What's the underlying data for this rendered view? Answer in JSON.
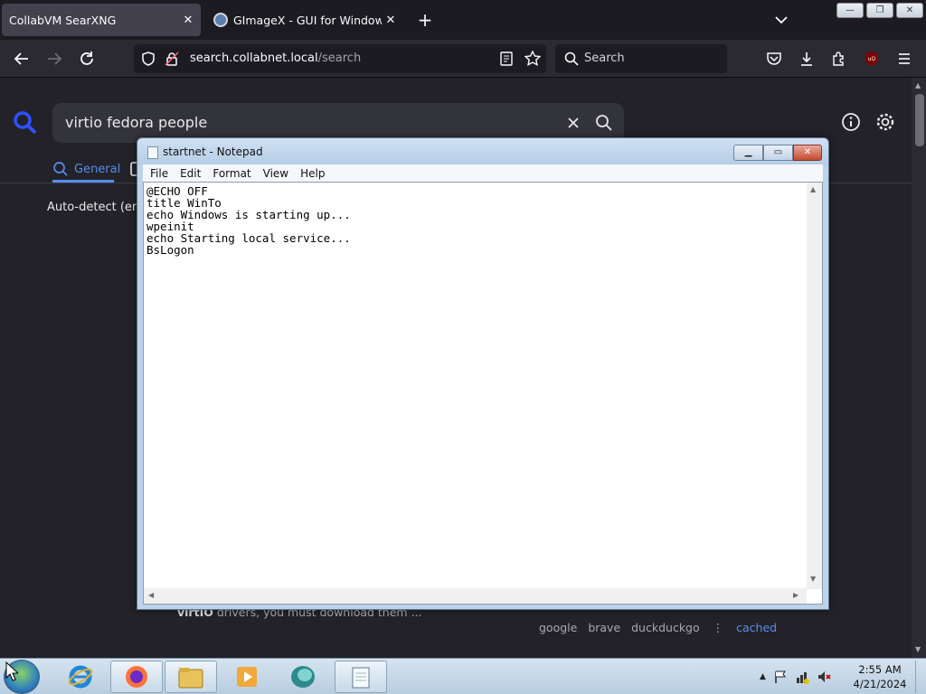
{
  "browser": {
    "tabs": [
      {
        "title": "CollabVM SearXNG",
        "active": true
      },
      {
        "title": "GImageX - GUI for Windows Im",
        "active": false
      }
    ],
    "url_domain": "search.collabnet.local",
    "url_path": "/search",
    "search_placeholder": "Search"
  },
  "page": {
    "query": "virtio fedora people",
    "tab_general": "General",
    "lang_filter": "Auto-detect (en-U",
    "snippet_bold": "virtIO",
    "snippet_rest": " drivers, you must download them ...",
    "engines": [
      "google",
      "brave",
      "duckduckgo"
    ],
    "engine_sep": "⋮",
    "cached": "cached",
    "accent_color": "#5a8dee"
  },
  "notepad": {
    "title": "startnet - Notepad",
    "menu": [
      "File",
      "Edit",
      "Format",
      "View",
      "Help"
    ],
    "content": "@ECHO OFF\ntitle WinTo\necho Windows is starting up...\nwpeinit\necho Starting local service...\nBsLogon"
  },
  "taskbar": {
    "apps": [
      "start-orb",
      "internet-explorer-icon",
      "firefox-icon",
      "file-explorer-icon",
      "media-player-icon",
      "gimagex-icon",
      "notepad-icon"
    ],
    "time": "2:55 AM",
    "date": "4/21/2024"
  }
}
